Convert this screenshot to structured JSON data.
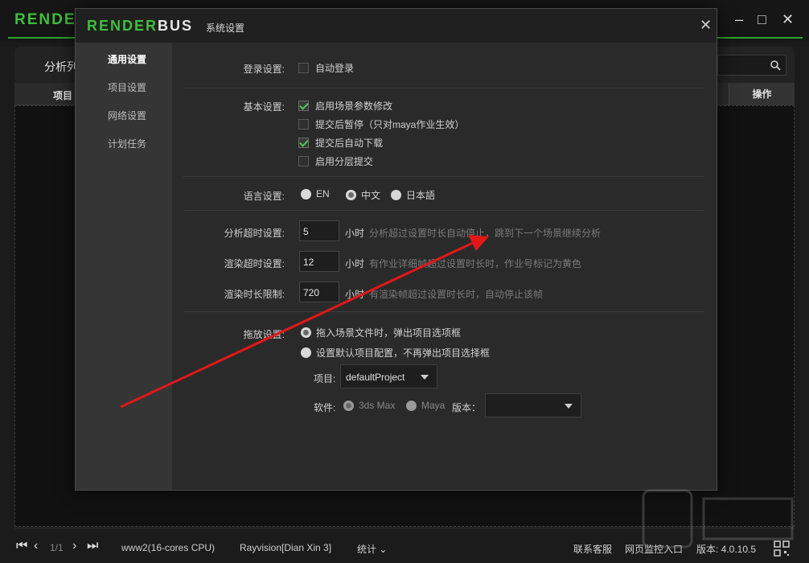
{
  "app": {
    "logo_left": "RENDER",
    "logo_right": "BUS",
    "minimize": "–",
    "maximize": "□",
    "close": "✕"
  },
  "background": {
    "tab_label": "分析列",
    "column_project": "项目",
    "column_action": "操作"
  },
  "dialog": {
    "title": "系统设置",
    "close": "✕",
    "sidebar": [
      {
        "label": "通用设置",
        "active": true
      },
      {
        "label": "项目设置",
        "active": false
      },
      {
        "label": "网络设置",
        "active": false
      },
      {
        "label": "计划任务",
        "active": false
      }
    ],
    "login": {
      "label": "登录设置:",
      "auto_login": {
        "label": "自动登录",
        "checked": false
      }
    },
    "basic": {
      "label": "基本设置:",
      "options": [
        {
          "label": "启用场景参数修改",
          "checked": true
        },
        {
          "label": "提交后暂停（只对maya作业生效）",
          "checked": false
        },
        {
          "label": "提交后自动下载",
          "checked": true
        },
        {
          "label": "启用分层提交",
          "checked": false
        }
      ]
    },
    "language": {
      "label": "语言设置:",
      "options": [
        {
          "label": "EN",
          "selected": false
        },
        {
          "label": "中文",
          "selected": true
        },
        {
          "label": "日本語",
          "selected": false
        }
      ]
    },
    "timeouts": [
      {
        "label": "分析超时设置:",
        "value": "5",
        "unit": "小时",
        "hint": "分析超过设置时长自动停止，跳到下一个场景继续分析"
      },
      {
        "label": "渲染超时设置:",
        "value": "12",
        "unit": "小时",
        "hint": "有作业详细帧超过设置时长时，作业号标记为黄色"
      },
      {
        "label": "渲染时长限制:",
        "value": "720",
        "unit": "小时",
        "hint": "有渲染帧超过设置时长时，自动停止该帧"
      }
    ],
    "drag": {
      "label": "拖放设置:",
      "options": [
        {
          "label": "拖入场景文件时，弹出项目选项框",
          "selected": true
        },
        {
          "label": "设置默认项目配置，不再弹出项目选择框",
          "selected": false
        }
      ],
      "project_label": "项目:",
      "project_value": "defaultProject",
      "software_label": "软件:",
      "software_options": [
        {
          "label": "3ds Max",
          "selected": true
        },
        {
          "label": "Maya",
          "selected": false
        }
      ],
      "version_label": "版本：",
      "version_value": ""
    }
  },
  "footer": {
    "page": "1/1",
    "machine": "www2(16-cores CPU)",
    "account": "Rayvision[Dian Xin 3]",
    "stats": "统计",
    "contact": "联系客服",
    "monitor": "网页监控入口",
    "version": "版本: 4.0.10.5"
  },
  "colors": {
    "accent": "#3fbf3f",
    "arrow": "#e01818"
  }
}
